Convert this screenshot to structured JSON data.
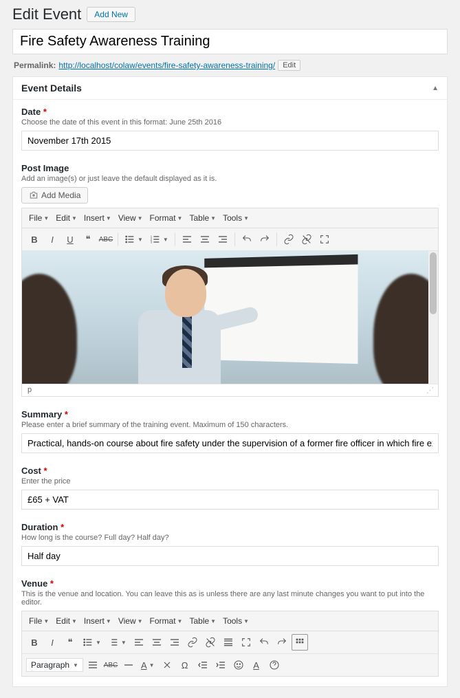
{
  "page": {
    "heading": "Edit Event",
    "add_new": "Add New",
    "title_value": "Fire Safety Awareness Training",
    "permalink_label": "Permalink:",
    "permalink_base": "http://localhost/colaw/events/",
    "permalink_slug": "fire-safety-awareness-training/",
    "edit_label": "Edit"
  },
  "metabox": {
    "title": "Event Details"
  },
  "fields": {
    "date": {
      "label": "Date",
      "desc": "Choose the date of this event in this format: June 25th 2016",
      "value": "November 17th 2015"
    },
    "post_image": {
      "label": "Post Image",
      "desc": "Add an image(s) or just leave the default displayed as it is.",
      "add_media": "Add Media",
      "status_path": "p"
    },
    "summary": {
      "label": "Summary",
      "desc": "Please enter a brief summary of the training event. Maximum of 150 characters.",
      "value": "Practical, hands-on course about fire safety under the supervision of a former fire officer in which fire extinguishers will be used."
    },
    "cost": {
      "label": "Cost",
      "desc": "Enter the price",
      "value": "£65 + VAT"
    },
    "duration": {
      "label": "Duration",
      "desc": "How long is the course? Full day? Half day?",
      "value": "Half day"
    },
    "venue": {
      "label": "Venue",
      "desc": "This is the venue and location. You can leave this as is unless there are any last minute changes you want to put into the editor.",
      "paragraph": "Paragraph"
    }
  },
  "editor_menu": {
    "file": "File",
    "edit": "Edit",
    "insert": "Insert",
    "view": "View",
    "format": "Format",
    "table": "Table",
    "tools": "Tools"
  }
}
